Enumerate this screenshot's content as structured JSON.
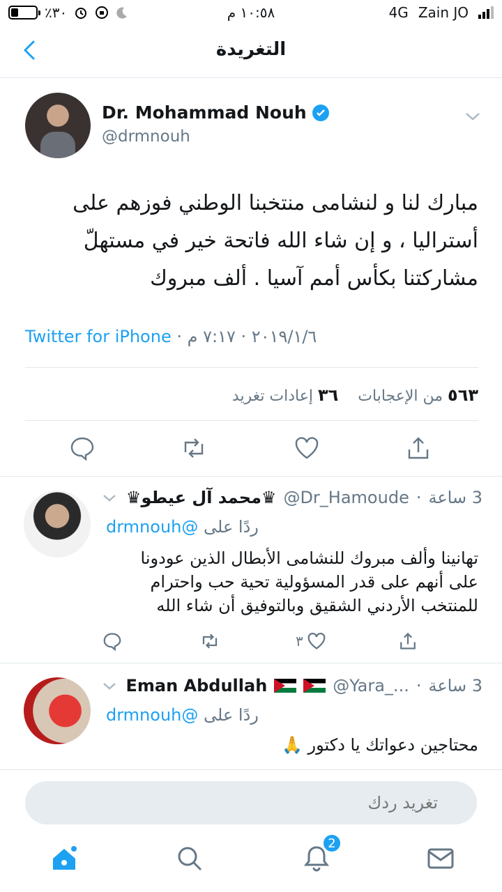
{
  "status_bar": {
    "battery_text": "٪٣٠",
    "battery_level": 0.3,
    "time": "١٠:٥٨ م",
    "network": "4G",
    "carrier": "Zain JO"
  },
  "header": {
    "title": "التغريدة"
  },
  "main_tweet": {
    "name": "Dr. Mohammad Nouh",
    "handle": "@drmnouh",
    "text": "مبارك لنا و لنشامى منتخبنا الوطني فوزهم على أستراليا ، و إن شاء الله  فاتحة خير في مستهلّ مشاركتنا بكأس أمم آسيا . ألف مبروك",
    "time": "٧:١٧ م",
    "date": "٢٠١٩/١/٦",
    "source": "Twitter for iPhone",
    "likes_count": "٥٦٣",
    "likes_label": "من الإعجابات",
    "retweets_count": "٣٦",
    "retweets_label": "إعادات تغريد"
  },
  "replies": [
    {
      "name": "♛محمد آل عيطو♛",
      "handle": "@Dr_Hamoude",
      "time": "3 ساعة",
      "reply_to_label": "ردًا على",
      "reply_to_handle": "@drmnouh",
      "text": "تهانينا وألف مبروك للنشامى الأبطال الذين عودونا على أنهم على قدر المسؤولية تحية حب واحترام للمنتخب الأردني الشقيق وبالتوفيق أن شاء الله",
      "like_count": "٣"
    },
    {
      "name": "Eman Abdullah",
      "handle": "@Yara_...",
      "time": "3 ساعة",
      "reply_to_label": "ردًا على",
      "reply_to_handle": "@drmnouh",
      "text": "محتاجين دعواتك يا دكتور 🙏"
    }
  ],
  "compose": {
    "placeholder": "تغريد ردك"
  },
  "tabbar": {
    "notifications_badge": "2"
  },
  "colors": {
    "accent": "#1da1f2",
    "secondary_text": "#657786",
    "divider": "#e1e8ed"
  }
}
